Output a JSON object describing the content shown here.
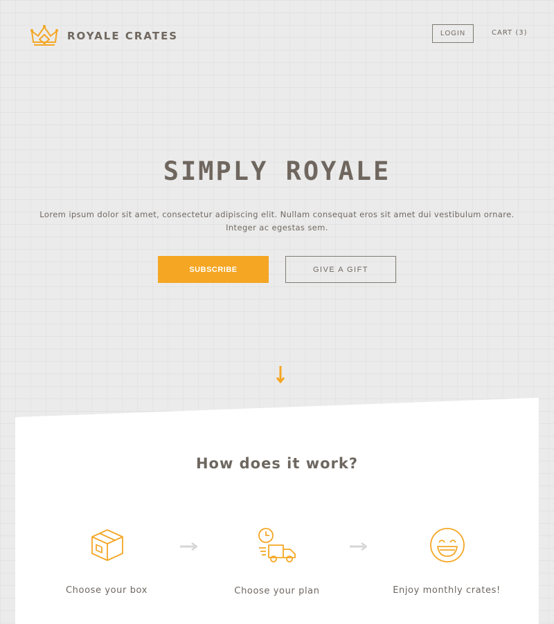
{
  "header": {
    "brand": "ROYALE CRATES",
    "logo_icon": "crown-icon",
    "login_label": "LOGIN",
    "cart_label": "CART (3)"
  },
  "hero": {
    "title": "SIMPLY ROYALE",
    "text": "Lorem ipsum dolor sit amet, consectetur adipiscing elit. Nullam consequat eros sit amet dui vestibulum ornare. Integer ac egestas sem.",
    "subscribe_label": "SUBSCRIBE",
    "gift_label": "GIVE A GIFT",
    "scroll_icon": "arrow-down-icon"
  },
  "how": {
    "title": "How does it work?",
    "steps": [
      {
        "label": "Choose your box",
        "icon": "box-icon"
      },
      {
        "label": "Choose your plan",
        "icon": "delivery-truck-icon"
      },
      {
        "label": "Enjoy monthly crates!",
        "icon": "smiley-icon"
      }
    ]
  },
  "colors": {
    "accent": "#f5a623",
    "text": "#6e6760",
    "background": "#ebebeb",
    "panel": "#ffffff"
  }
}
